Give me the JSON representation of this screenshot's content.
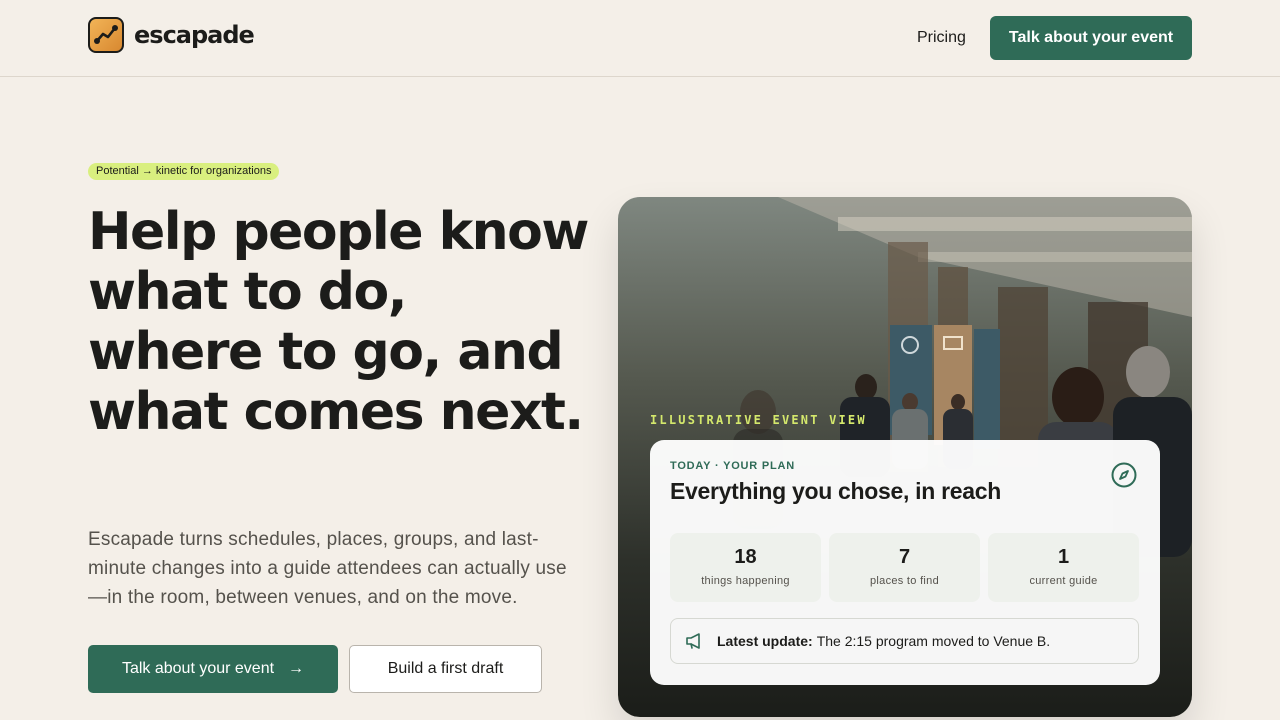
{
  "header": {
    "brand": "escapade",
    "nav": {
      "pricing": "Pricing"
    },
    "cta": "Talk about your event"
  },
  "hero": {
    "badge": "Potential → kinetic for organizations",
    "headline": "Help people know what to do, where to go, and what comes next.",
    "lede": "Escapade turns schedules, places, groups, and last-minute changes into a guide attendees can actually use—in the room, between venues, and on the move.",
    "primary_button": "Talk about your event",
    "primary_button_arrow": "→",
    "secondary_button": "Build a first draft"
  },
  "preview": {
    "label": "ILLUSTRATIVE EVENT VIEW",
    "kicker": "TODAY · YOUR PLAN",
    "title": "Everything you chose, in reach",
    "stats": [
      {
        "value": "18",
        "label": "things happening"
      },
      {
        "value": "7",
        "label": "places to find"
      },
      {
        "value": "1",
        "label": "current guide"
      }
    ],
    "update_label": "Latest update:",
    "update_text": "The 2:15 program moved to Venue B."
  },
  "colors": {
    "background": "#f4efe8",
    "accent": "#2f6b57",
    "badge": "#d9ef7f",
    "label_highlight": "#d4e86c"
  },
  "icons": [
    "logo-icon",
    "arrow-right-icon",
    "compass-icon",
    "megaphone-icon"
  ]
}
